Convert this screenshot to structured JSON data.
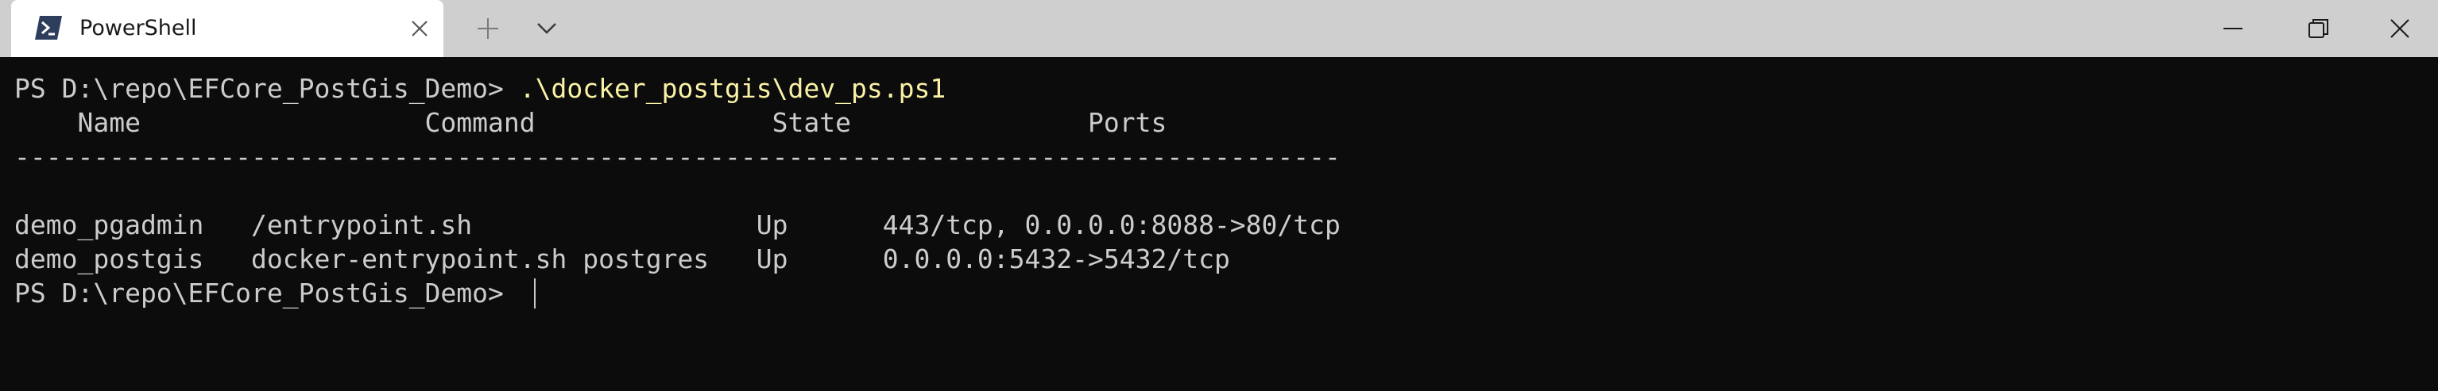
{
  "window": {
    "tab_title": "PowerShell"
  },
  "icons": {
    "tab_icon": "powershell-icon",
    "tab_close": "close-icon",
    "new_tab": "plus-icon",
    "dropdown": "chevron-down-icon",
    "minimize": "minimize-icon",
    "restore": "restore-icon",
    "close": "close-icon"
  },
  "colors": {
    "titlebar": "#cfcfcf",
    "terminal_bg": "#0c0c0c",
    "terminal_fg": "#cccccc",
    "command": "#f9f1a5"
  },
  "terminal": {
    "prompt": "PS D:\\repo\\EFCore_PostGis_Demo> ",
    "command": ".\\docker_postgis\\dev_ps.ps1",
    "header": "    Name                  Command               State               Ports",
    "separator": "------------------------------------------------------------------------------------",
    "rows": [
      "demo_pgadmin   /entrypoint.sh                  Up      443/tcp, 0.0.0.0:8088->80/tcp",
      "demo_postgis   docker-entrypoint.sh postgres   Up      0.0.0.0:5432->5432/tcp"
    ],
    "final_prompt": "PS D:\\repo\\EFCore_PostGis_Demo> "
  }
}
